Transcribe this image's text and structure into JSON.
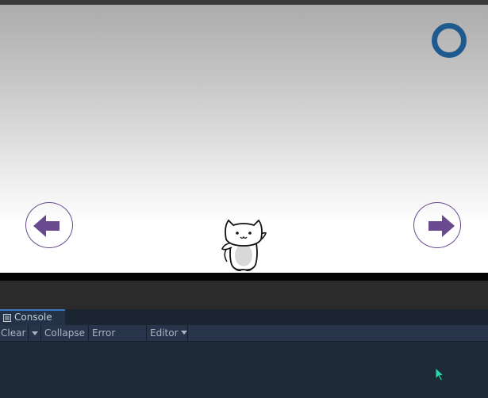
{
  "console": {
    "tab_label": "Console",
    "toolbar": {
      "clear_label": "Clear",
      "collapse_label": "Collapse",
      "error_pause_label": "Error Pause",
      "editor_label": "Editor"
    }
  },
  "game": {
    "ring_color": "#1f5a8e",
    "arrow_color": "#6a4a8e",
    "left_button_icon": "left-arrow-icon",
    "right_button_icon": "right-arrow-icon",
    "character_icon": "cat-character"
  }
}
